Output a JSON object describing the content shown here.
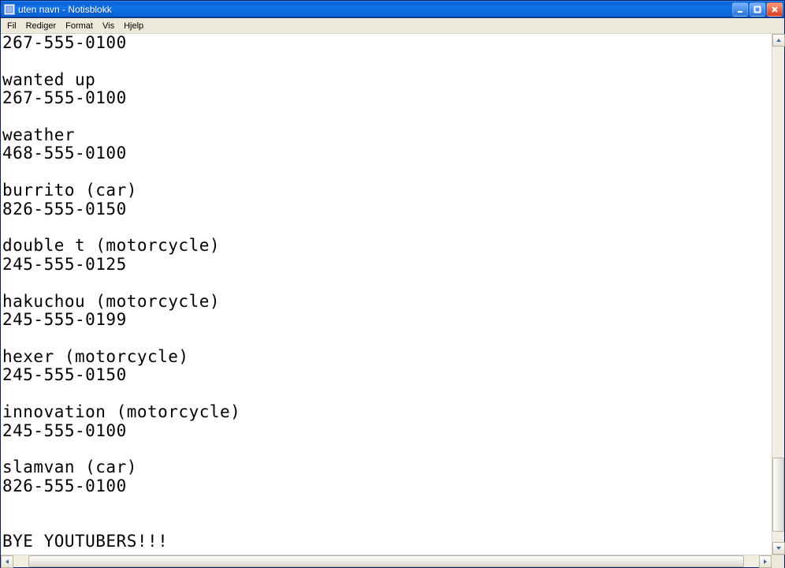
{
  "window": {
    "title": "uten navn - Notisblokk"
  },
  "menu": {
    "file": "Fil",
    "edit": "Rediger",
    "format": "Format",
    "view": "Vis",
    "help": "Hjelp"
  },
  "document": {
    "text": "267-555-0100\n\nwanted up\n267-555-0100\n\nweather\n468-555-0100\n\nburrito (car)\n826-555-0150\n\ndouble t (motorcycle)\n245-555-0125\n\nhakuchou (motorcycle)\n245-555-0199\n\nhexer (motorcycle)\n245-555-0150\n\ninnovation (motorcycle)\n245-555-0100\n\nslamvan (car)\n826-555-0100\n\n\nBYE YOUTUBERS!!!"
  },
  "scroll": {
    "v_thumb_top_pct": 83,
    "v_thumb_height_pct": 15,
    "h_thumb_left_pct": 2,
    "h_thumb_width_pct": 96
  }
}
